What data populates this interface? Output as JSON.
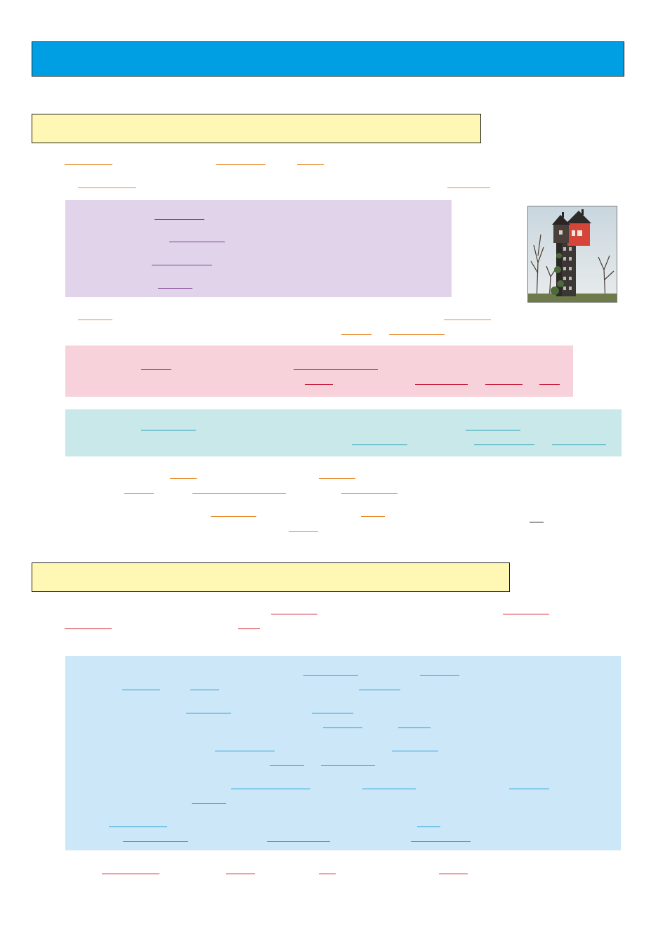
{
  "header": {
    "title_bar_color": "#009fe3",
    "section_header_color": "#fff8b4"
  },
  "colors": {
    "orange_blank": "#e8892b",
    "purple_blank": "#7c3f8f",
    "pink_blank": "#c8193a",
    "teal_blank": "#1c9bb0",
    "red_blank": "#d01f2e",
    "cyan_blank": "#1f9fd6",
    "purple_box": "#e0d3ea",
    "pink_box": "#f8d2da",
    "teal_box": "#c9e8ea",
    "blue_box": "#cbe7f8"
  },
  "image": {
    "icon": "tower-house-photo"
  }
}
